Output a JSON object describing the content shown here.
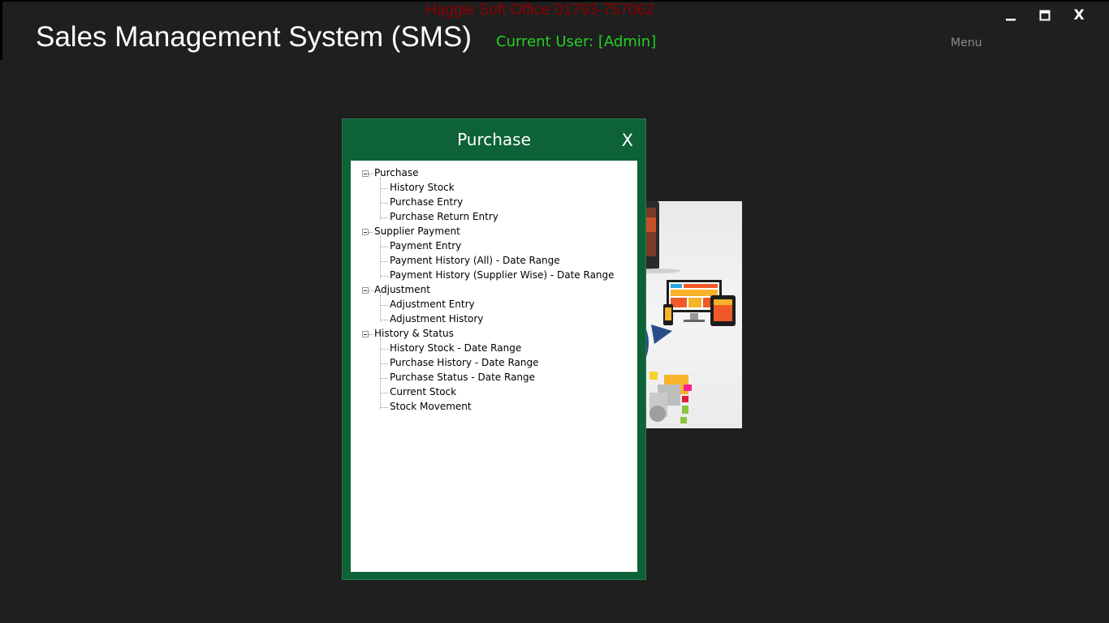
{
  "header": {
    "company": "Haggle Soft Office 01793-757062",
    "title": "Sales Management System (SMS)",
    "current_user": "Current User: [Admin]",
    "menu_label": "Menu"
  },
  "window_controls": {
    "minimize_icon": "minimize-icon",
    "maximize_icon": "maximize-icon",
    "close_label": "X"
  },
  "dialog": {
    "title": "Purchase",
    "close_label": "X"
  },
  "tree": [
    {
      "label": "Purchase",
      "expanded": true,
      "children": [
        "History Stock",
        "Purchase Entry",
        "Purchase Return Entry"
      ]
    },
    {
      "label": "Supplier Payment",
      "expanded": true,
      "children": [
        "Payment Entry",
        "Payment History (All) - Date Range",
        "Payment History (Supplier Wise) - Date Range"
      ]
    },
    {
      "label": "Adjustment",
      "expanded": true,
      "children": [
        "Adjustment Entry",
        "Adjustment History"
      ]
    },
    {
      "label": "History & Status",
      "expanded": true,
      "children": [
        "History Stock - Date Range",
        "Purchase History - Date Range",
        "Purchase Status - Date Range",
        "Current Stock",
        "Stock Movement"
      ]
    }
  ],
  "colors": {
    "background": "#1f1f1f",
    "dialog": "#0d6238",
    "company_text": "#8b0000",
    "user_text": "#22d022"
  }
}
